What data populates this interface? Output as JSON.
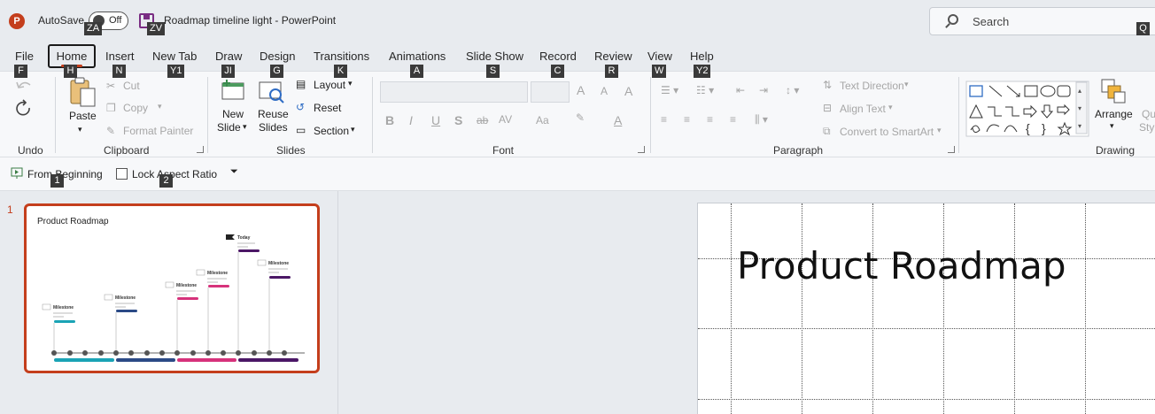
{
  "titlebar": {
    "app_logo": "P",
    "autosave_label": "AutoSave",
    "autosave_state": "Off",
    "document_title": "Roadmap timeline light  -  PowerPoint",
    "search_placeholder": "Search"
  },
  "keytips": {
    "autosave": "ZA",
    "save": "ZV",
    "search": "Q",
    "file": "F",
    "home": "H",
    "insert": "N",
    "new_tab": "Y1",
    "draw": "JI",
    "design": "G",
    "transitions": "K",
    "animations": "A",
    "slide_show": "S",
    "record": "C",
    "review": "R",
    "view": "W",
    "help": "Y2",
    "from_beginning": "1",
    "lock_aspect": "2"
  },
  "tabs": [
    "File",
    "Home",
    "Insert",
    "New Tab",
    "Draw",
    "Design",
    "Transitions",
    "Animations",
    "Slide Show",
    "Record",
    "Review",
    "View",
    "Help"
  ],
  "ribbon": {
    "groups": {
      "undo": "Undo",
      "clipboard": "Clipboard",
      "slides": "Slides",
      "font": "Font",
      "paragraph": "Paragraph",
      "drawing": "Drawing"
    },
    "clipboard": {
      "paste": "Paste",
      "cut": "Cut",
      "copy": "Copy",
      "format_painter": "Format Painter"
    },
    "slides": {
      "new_slide_1": "New",
      "new_slide_2": "Slide",
      "reuse_1": "Reuse",
      "reuse_2": "Slides",
      "layout": "Layout",
      "reset": "Reset",
      "section": "Section"
    },
    "font": {
      "bold": "B",
      "italic": "I",
      "underline": "U",
      "shadow": "S",
      "strike": "ab",
      "spacing": "AV",
      "case": "Aa",
      "grow": "A",
      "shrink": "A",
      "clear": "A",
      "font_color": "A"
    },
    "paragraph": {
      "text_direction": "Text Direction",
      "align_text": "Align Text",
      "convert_smartart": "Convert to SmartArt"
    },
    "drawing": {
      "arrange": "Arrange",
      "quick_styles_1": "Qu",
      "quick_styles_2": "Styl"
    }
  },
  "quickbar": {
    "from_beginning": "From Beginning",
    "lock_aspect_ratio": "Lock Aspect Ratio",
    "lock_checked": false
  },
  "thumbnail": {
    "slide_number": "1",
    "title": "Product Roadmap",
    "milestones": [
      "Milestone",
      "Milestone",
      "Milestone",
      "Milestone",
      "Today",
      "Milestone"
    ]
  },
  "slide": {
    "title": "Product Roadmap"
  },
  "colors": {
    "accent": "#c43e1c",
    "teal": "#1aa3b5",
    "navy": "#2b4a86",
    "pink": "#d6327b",
    "purple": "#4b1766"
  }
}
